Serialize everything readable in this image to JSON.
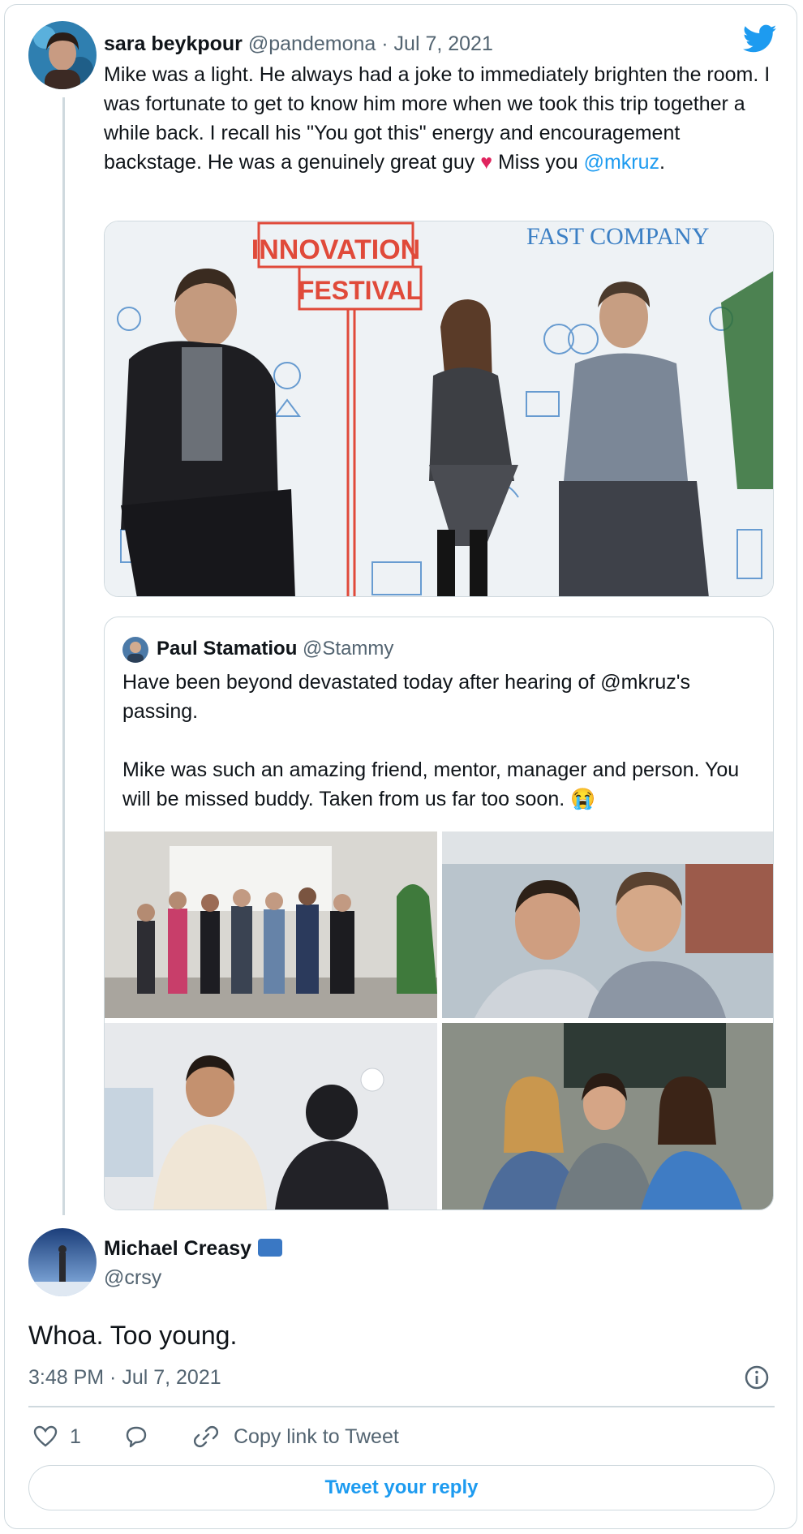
{
  "original_tweet": {
    "author_name": "sara beykpour",
    "author_handle": "@pandemona",
    "separator": "·",
    "date": "Jul 7, 2021",
    "text_before_heart": "Mike was a light. He always had a joke to immediately brighten the room. I was fortunate to get to know him more when we took this trip together a while back. I recall his \"You got this\" energy and encouragement backstage. He was a genuinely great guy ",
    "heart": "♥",
    "text_after_heart": "  Miss you ",
    "mention": "@mkruz",
    "text_end": ".",
    "photo_banner_top": "INNOVATION",
    "photo_banner_bottom": "FESTIVAL",
    "photo_brand": "FAST COMPANY"
  },
  "quoted_tweet": {
    "author_name": "Paul Stamatiou",
    "author_handle": "@Stammy",
    "paragraph1": "Have been beyond devastated today after hearing of @mkruz's passing.",
    "paragraph2": "Mike was such an amazing friend, mentor, manager and person. You will be missed buddy. Taken from us far too soon. ",
    "emoji": "😭"
  },
  "reply": {
    "author_name": "Michael Creasy",
    "author_handle": "@crsy",
    "text": "Whoa. Too young.",
    "timestamp": "3:48 PM · Jul 7, 2021"
  },
  "actions": {
    "like_count": "1",
    "copy_link_label": "Copy link to Tweet"
  },
  "reply_button": {
    "label": "Tweet your reply"
  },
  "icons": [
    "twitter-bird-icon",
    "heart-icon",
    "reply-bubble-icon",
    "link-icon",
    "info-icon",
    "verified-badge-icon"
  ],
  "colors": {
    "accent": "#1d9bf0",
    "muted": "#536471",
    "heart": "#e0245e",
    "border": "#cfd9de"
  }
}
